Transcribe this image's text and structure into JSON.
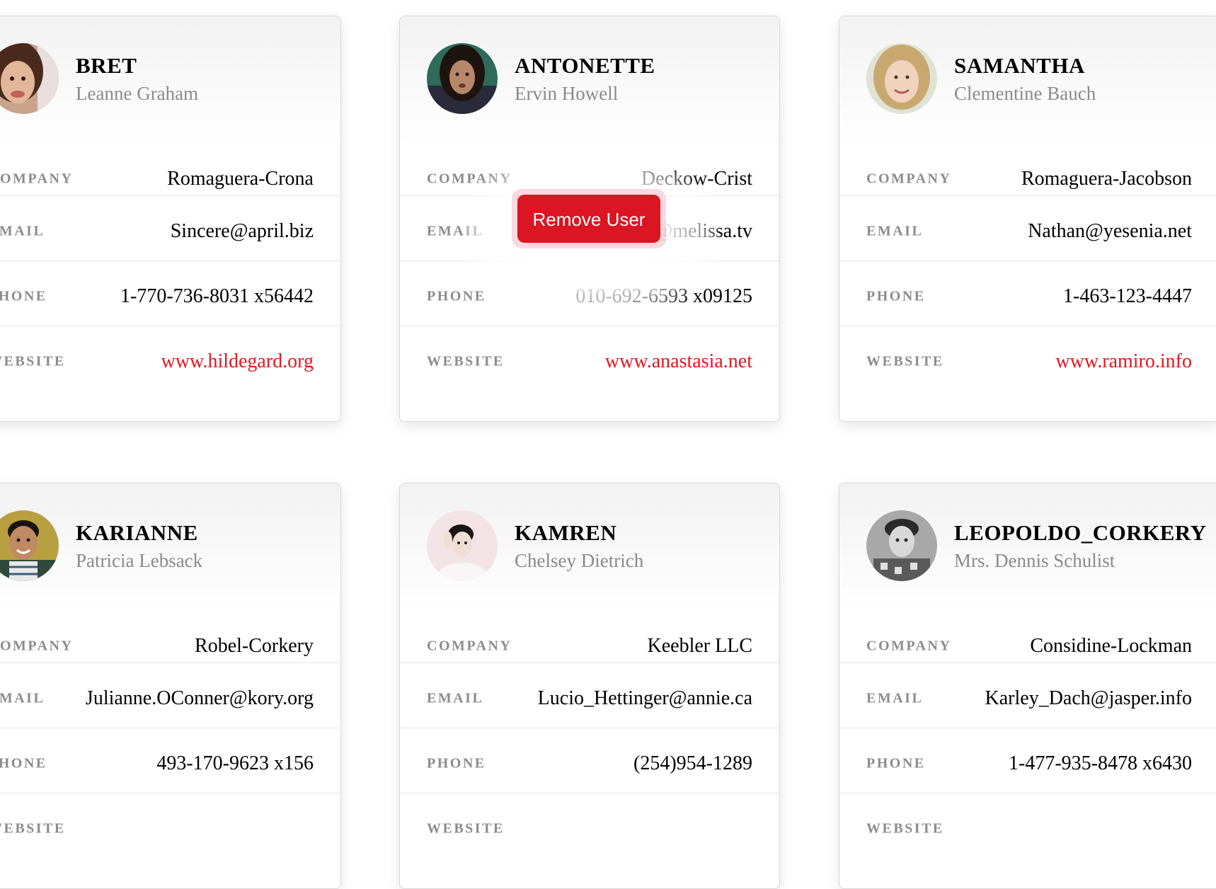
{
  "labels": {
    "company": "COMPANY",
    "email": "EMAIL",
    "phone": "PHONE",
    "website": "WEBSITE"
  },
  "remove_button_label": "Remove User",
  "colors": {
    "link": "#e8141e",
    "remove_button": "#db1521",
    "label": "#8c8c8c",
    "fullname": "#8a8a8a"
  },
  "users": [
    {
      "username": "BRET",
      "name": "Leanne Graham",
      "company": "Romaguera-Crona",
      "email": "Sincere@april.biz",
      "phone": "1-770-736-8031 x56442",
      "website": "www.hildegard.org",
      "avatar": "woman-brown-hair-photo"
    },
    {
      "username": "ANTONETTE",
      "name": "Ervin Howell",
      "company": "Deckow-Crist",
      "email": "Shanna@melissa.tv",
      "phone": "010-692-6593 x09125",
      "website": "www.anastasia.net",
      "avatar": "man-long-hair-photo"
    },
    {
      "username": "SAMANTHA",
      "name": "Clementine Bauch",
      "company": "Romaguera-Jacobson",
      "email": "Nathan@yesenia.net",
      "phone": "1-463-123-4447",
      "website": "www.ramiro.info",
      "avatar": "woman-blonde-photo"
    },
    {
      "username": "KARIANNE",
      "name": "Patricia Lebsack",
      "company": "Robel-Corkery",
      "email": "Julianne.OConner@kory.org",
      "phone": "493-170-9623 x156",
      "website": "",
      "avatar": "man-smiling-photo"
    },
    {
      "username": "KAMREN",
      "name": "Chelsey Dietrich",
      "company": "Keebler LLC",
      "email": "Lucio_Hettinger@annie.ca",
      "phone": "(254)954-1289",
      "website": "",
      "avatar": "person-pink-background-photo"
    },
    {
      "username": "LEOPOLDO_CORKERY",
      "name": "Mrs. Dennis Schulist",
      "company": "Considine-Lockman",
      "email": "Karley_Dach@jasper.info",
      "phone": "1-477-935-8478 x6430",
      "website": "",
      "avatar": "man-grayscale-photo"
    }
  ]
}
